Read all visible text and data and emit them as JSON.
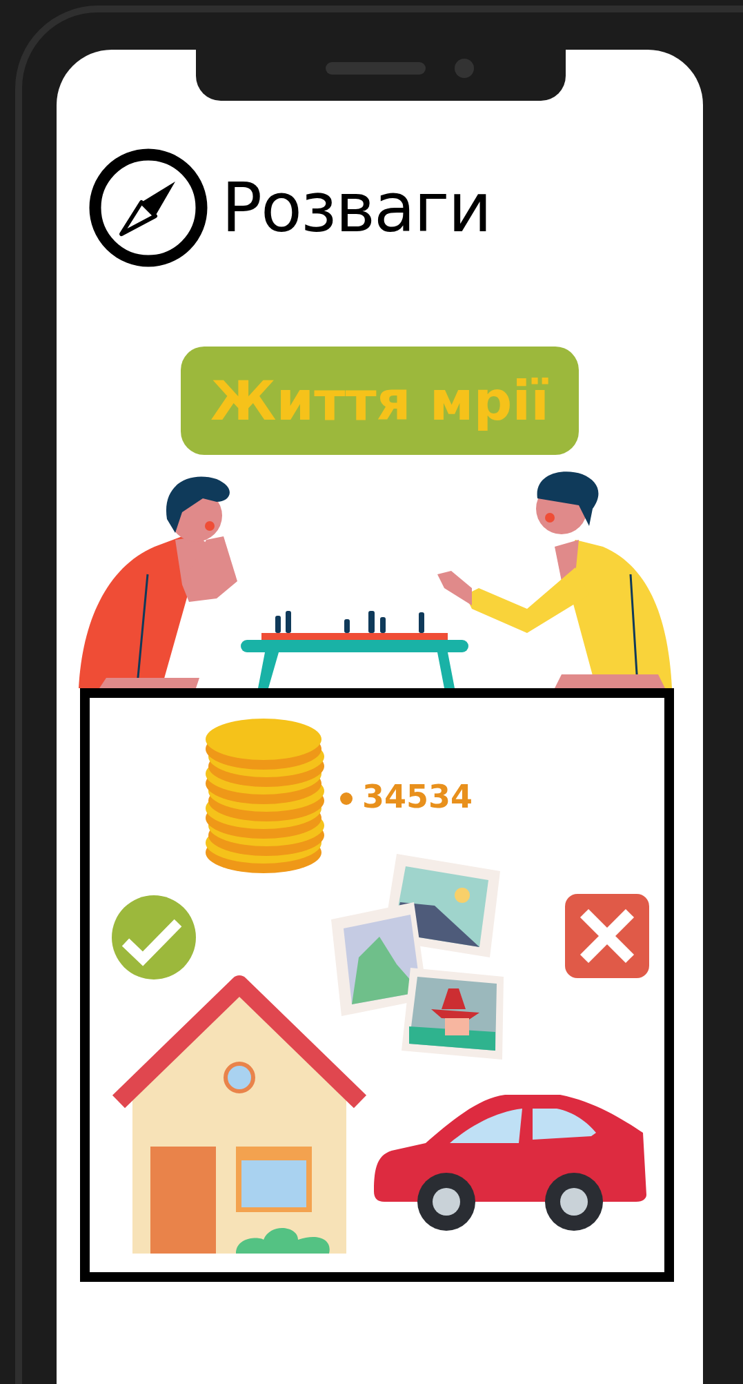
{
  "app": {
    "title": "Розваги"
  },
  "banner": {
    "text": "Життя мрії"
  },
  "board": {
    "coins": {
      "amount": "34534"
    }
  }
}
